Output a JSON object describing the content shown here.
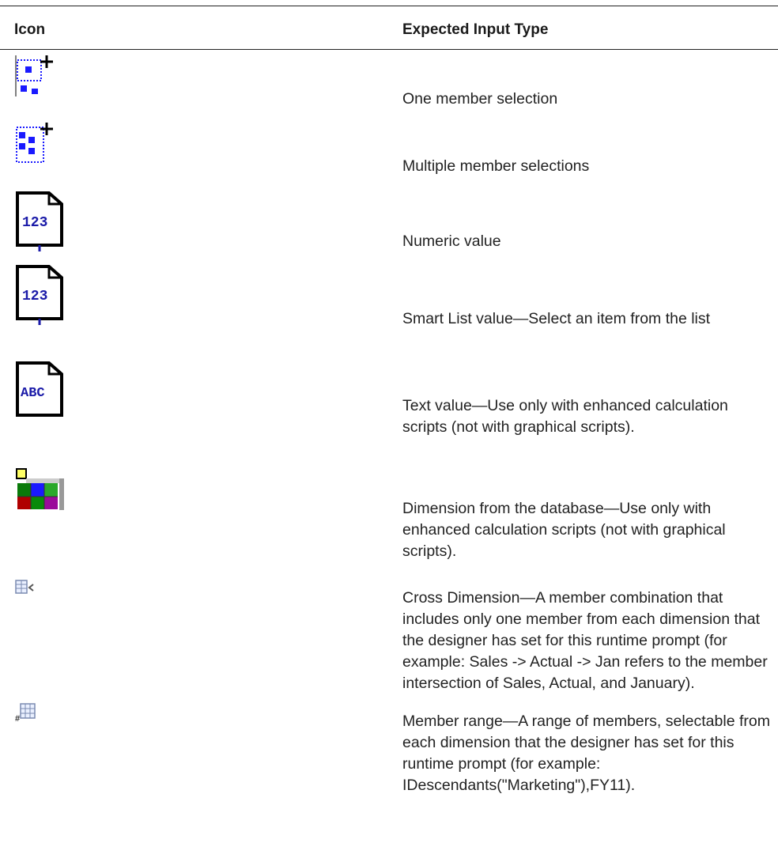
{
  "table": {
    "headers": {
      "icon": "Icon",
      "expected_input_type": "Expected Input Type"
    },
    "rows": [
      {
        "icon": "single-member-select-icon",
        "description": "One member selection"
      },
      {
        "icon": "multiple-member-select-icon",
        "description": "Multiple member selections"
      },
      {
        "icon": "numeric-document-icon",
        "description": "Numeric value"
      },
      {
        "icon": "smart-list-document-icon",
        "description": "Smart List value—Select an item from the list"
      },
      {
        "icon": "text-document-icon",
        "description": "Text value—Use only with enhanced calculation scripts (not with graphical scripts)."
      },
      {
        "icon": "dimension-cube-icon",
        "description": "Dimension from the database—Use only with enhanced calculation scripts (not with graphical scripts)."
      },
      {
        "icon": "cross-dimension-grid-icon",
        "description": "Cross Dimension—A member combination that includes only one member from each dimension that the designer has set for this runtime prompt (for example: Sales -> Actual -> Jan refers to the member intersection of Sales, Actual, and January)."
      },
      {
        "icon": "member-range-grid-icon",
        "description": "Member range—A range of members, selectable from each dimension that the designer has set for this runtime prompt (for example: IDescendants(\"Marketing\"),FY11)."
      }
    ]
  }
}
